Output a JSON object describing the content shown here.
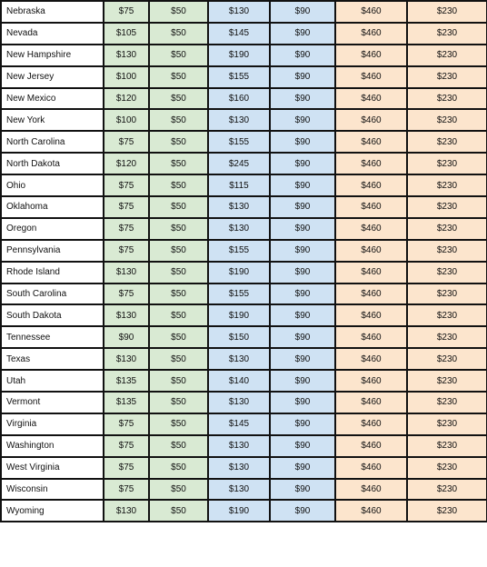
{
  "column_colors": [
    "#ffffff",
    "#d9ead3",
    "#d9ead3",
    "#cfe2f3",
    "#cfe2f3",
    "#fce5cd",
    "#fce5cd"
  ],
  "rows": [
    [
      "Nebraska",
      "$75",
      "$50",
      "$130",
      "$90",
      "$460",
      "$230"
    ],
    [
      "Nevada",
      "$105",
      "$50",
      "$145",
      "$90",
      "$460",
      "$230"
    ],
    [
      "New Hampshire",
      "$130",
      "$50",
      "$190",
      "$90",
      "$460",
      "$230"
    ],
    [
      "New Jersey",
      "$100",
      "$50",
      "$155",
      "$90",
      "$460",
      "$230"
    ],
    [
      "New Mexico",
      "$120",
      "$50",
      "$160",
      "$90",
      "$460",
      "$230"
    ],
    [
      "New York",
      "$100",
      "$50",
      "$130",
      "$90",
      "$460",
      "$230"
    ],
    [
      "North Carolina",
      "$75",
      "$50",
      "$155",
      "$90",
      "$460",
      "$230"
    ],
    [
      "North Dakota",
      "$120",
      "$50",
      "$245",
      "$90",
      "$460",
      "$230"
    ],
    [
      "Ohio",
      "$75",
      "$50",
      "$115",
      "$90",
      "$460",
      "$230"
    ],
    [
      "Oklahoma",
      "$75",
      "$50",
      "$130",
      "$90",
      "$460",
      "$230"
    ],
    [
      "Oregon",
      "$75",
      "$50",
      "$130",
      "$90",
      "$460",
      "$230"
    ],
    [
      "Pennsylvania",
      "$75",
      "$50",
      "$155",
      "$90",
      "$460",
      "$230"
    ],
    [
      "Rhode Island",
      "$130",
      "$50",
      "$190",
      "$90",
      "$460",
      "$230"
    ],
    [
      "South Carolina",
      "$75",
      "$50",
      "$155",
      "$90",
      "$460",
      "$230"
    ],
    [
      "South Dakota",
      "$130",
      "$50",
      "$190",
      "$90",
      "$460",
      "$230"
    ],
    [
      "Tennessee",
      "$90",
      "$50",
      "$150",
      "$90",
      "$460",
      "$230"
    ],
    [
      "Texas",
      "$130",
      "$50",
      "$130",
      "$90",
      "$460",
      "$230"
    ],
    [
      "Utah",
      "$135",
      "$50",
      "$140",
      "$90",
      "$460",
      "$230"
    ],
    [
      "Vermont",
      "$135",
      "$50",
      "$130",
      "$90",
      "$460",
      "$230"
    ],
    [
      "Virginia",
      "$75",
      "$50",
      "$145",
      "$90",
      "$460",
      "$230"
    ],
    [
      "Washington",
      "$75",
      "$50",
      "$130",
      "$90",
      "$460",
      "$230"
    ],
    [
      "West Virginia",
      "$75",
      "$50",
      "$130",
      "$90",
      "$460",
      "$230"
    ],
    [
      "Wisconsin",
      "$75",
      "$50",
      "$130",
      "$90",
      "$460",
      "$230"
    ],
    [
      "Wyoming",
      "$130",
      "$50",
      "$190",
      "$90",
      "$460",
      "$230"
    ]
  ]
}
